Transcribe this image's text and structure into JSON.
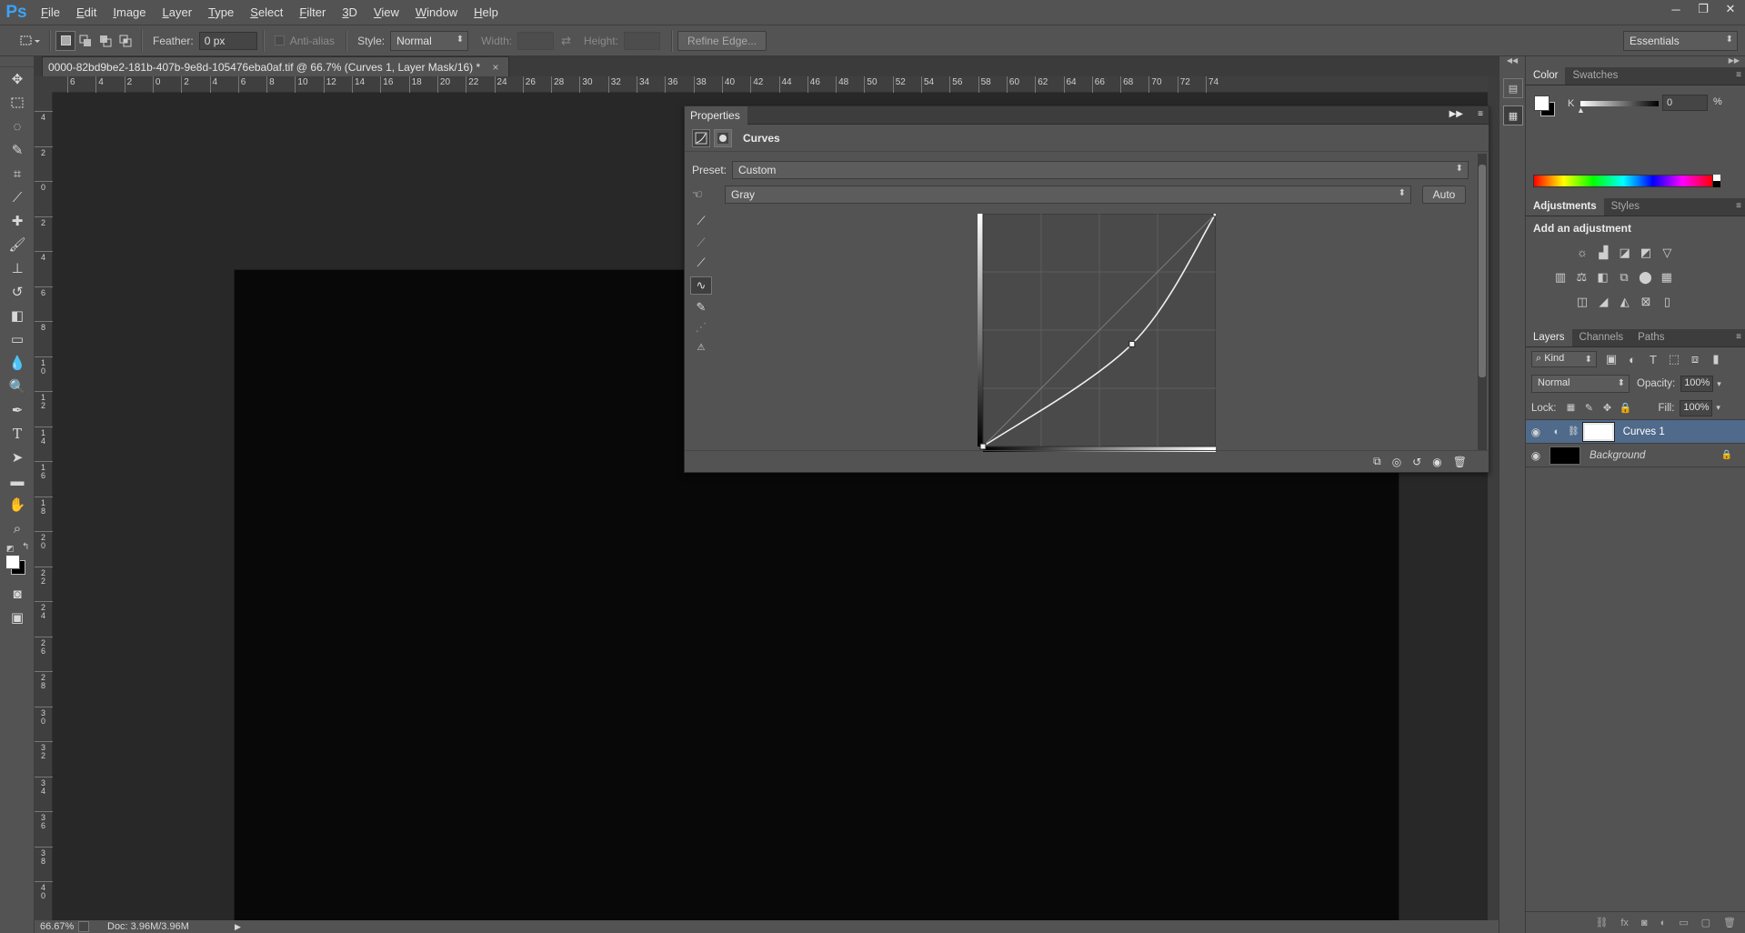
{
  "app": {
    "logo": "Ps",
    "menus": [
      "File",
      "Edit",
      "Image",
      "Layer",
      "Type",
      "Select",
      "Filter",
      "3D",
      "View",
      "Window",
      "Help"
    ],
    "window_controls": [
      "─",
      "❐",
      "✕"
    ]
  },
  "options_bar": {
    "feather_label": "Feather:",
    "feather_value": "0 px",
    "antialias_label": "Anti-alias",
    "style_label": "Style:",
    "style_value": "Normal",
    "width_label": "Width:",
    "height_label": "Height:",
    "refine_edge": "Refine Edge...",
    "workspace": "Essentials"
  },
  "document": {
    "tab_title": "0000-82bd9be2-181b-407b-9e8d-105476eba0af.tif @ 66.7% (Curves 1, Layer Mask/16) *",
    "tab_close": "×",
    "ruler_top_labels": [
      "6",
      "4",
      "2",
      "0",
      "2",
      "4",
      "6",
      "8",
      "10",
      "12",
      "14",
      "16",
      "18",
      "20",
      "22",
      "24",
      "26",
      "28",
      "30",
      "32",
      "34",
      "36",
      "38",
      "40",
      "42",
      "44",
      "46",
      "48",
      "50",
      "52",
      "54",
      "56",
      "58",
      "60",
      "62",
      "64",
      "66",
      "68",
      "70",
      "72",
      "74"
    ],
    "ruler_left_labels": [
      "4",
      "2",
      "0",
      "2",
      "4",
      "6",
      "8",
      "10",
      "12",
      "14",
      "16",
      "18",
      "20",
      "22",
      "24",
      "26",
      "28",
      "30",
      "32",
      "34",
      "36",
      "38",
      "40"
    ]
  },
  "status": {
    "zoom": "66.67%",
    "doc": "Doc: 3.96M/3.96M"
  },
  "properties": {
    "panel_title": "Properties",
    "adjustment_name": "Curves",
    "preset_label": "Preset:",
    "preset_value": "Custom",
    "channel_value": "Gray",
    "auto_label": "Auto",
    "curve_points": [
      [
        0,
        0
      ],
      [
        64,
        44
      ],
      [
        100,
        100
      ]
    ]
  },
  "color_panel": {
    "tabs": [
      "Color",
      "Swatches"
    ],
    "channel_label": "K",
    "value": "0",
    "unit": "%"
  },
  "adjustments_panel": {
    "tabs": [
      "Adjustments",
      "Styles"
    ],
    "heading": "Add an adjustment"
  },
  "layers_panel": {
    "tabs": [
      "Layers",
      "Channels",
      "Paths"
    ],
    "filter_kind": "Kind",
    "blend_mode": "Normal",
    "opacity_label": "Opacity:",
    "opacity_value": "100%",
    "lock_label": "Lock:",
    "fill_label": "Fill:",
    "fill_value": "100%",
    "layers": [
      {
        "name": "Curves 1",
        "selected": true
      },
      {
        "name": "Background",
        "selected": false
      }
    ]
  }
}
